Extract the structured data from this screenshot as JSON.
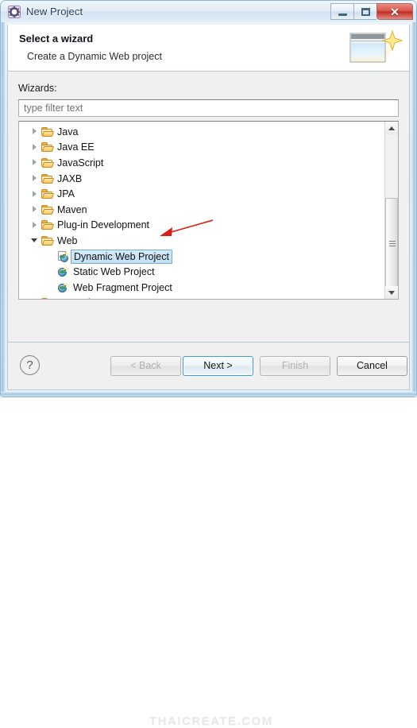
{
  "window": {
    "title": "New Project",
    "icon": "eclipse-gear-icon",
    "controls": {
      "minimize": "–",
      "maximize": "□",
      "close": "✕"
    }
  },
  "header": {
    "title": "Select a wizard",
    "subtitle": "Create a Dynamic Web project",
    "art_icon": "wizard-window-sparkle-icon"
  },
  "body": {
    "wizards_label": "Wizards:",
    "filter": {
      "value": "",
      "placeholder": "type filter text"
    },
    "tree": [
      {
        "label": "Java",
        "icon": "folder-icon",
        "level": 0,
        "state": "collapsed",
        "selected": false
      },
      {
        "label": "Java EE",
        "icon": "folder-icon",
        "level": 0,
        "state": "collapsed",
        "selected": false
      },
      {
        "label": "JavaScript",
        "icon": "folder-icon",
        "level": 0,
        "state": "collapsed",
        "selected": false
      },
      {
        "label": "JAXB",
        "icon": "folder-icon",
        "level": 0,
        "state": "collapsed",
        "selected": false
      },
      {
        "label": "JPA",
        "icon": "folder-icon",
        "level": 0,
        "state": "collapsed",
        "selected": false
      },
      {
        "label": "Maven",
        "icon": "folder-icon",
        "level": 0,
        "state": "collapsed",
        "selected": false
      },
      {
        "label": "Plug-in Development",
        "icon": "folder-icon",
        "level": 0,
        "state": "collapsed",
        "selected": false
      },
      {
        "label": "Web",
        "icon": "folder-icon",
        "level": 0,
        "state": "expanded",
        "selected": false
      },
      {
        "label": "Dynamic Web Project",
        "icon": "dynamic-web-project-icon",
        "level": 1,
        "state": "leaf",
        "selected": true
      },
      {
        "label": "Static Web Project",
        "icon": "static-web-project-icon",
        "level": 1,
        "state": "leaf",
        "selected": false
      },
      {
        "label": "Web Fragment Project",
        "icon": "web-fragment-project-icon",
        "level": 1,
        "state": "leaf",
        "selected": false
      },
      {
        "label": "Examples",
        "icon": "folder-icon",
        "level": 0,
        "state": "collapsed",
        "selected": false
      }
    ],
    "scrollbar": {
      "up_arrow": "▲",
      "down_arrow": "▼"
    }
  },
  "footer": {
    "help_label": "?",
    "buttons": [
      {
        "label": "< Back",
        "state": "disabled"
      },
      {
        "label": "Next >",
        "state": "default"
      },
      {
        "label": "Finish",
        "state": "disabled"
      },
      {
        "label": "Cancel",
        "state": "enabled"
      }
    ]
  },
  "annotations": {
    "arrow_color": "#d91f12",
    "arrow_target": "Dynamic Web Project"
  },
  "watermarks": {
    "footer": "THAICREATE.COM",
    "body": "THAICREATE.COM"
  },
  "colors": {
    "selection_fill": "#c8e3f4",
    "selection_border": "#7aa8c8",
    "default_button_border": "#3c9fd0",
    "close_button": "#bf2c23",
    "folder": "#f0b24a",
    "accent_text": "#1e3c5c"
  }
}
